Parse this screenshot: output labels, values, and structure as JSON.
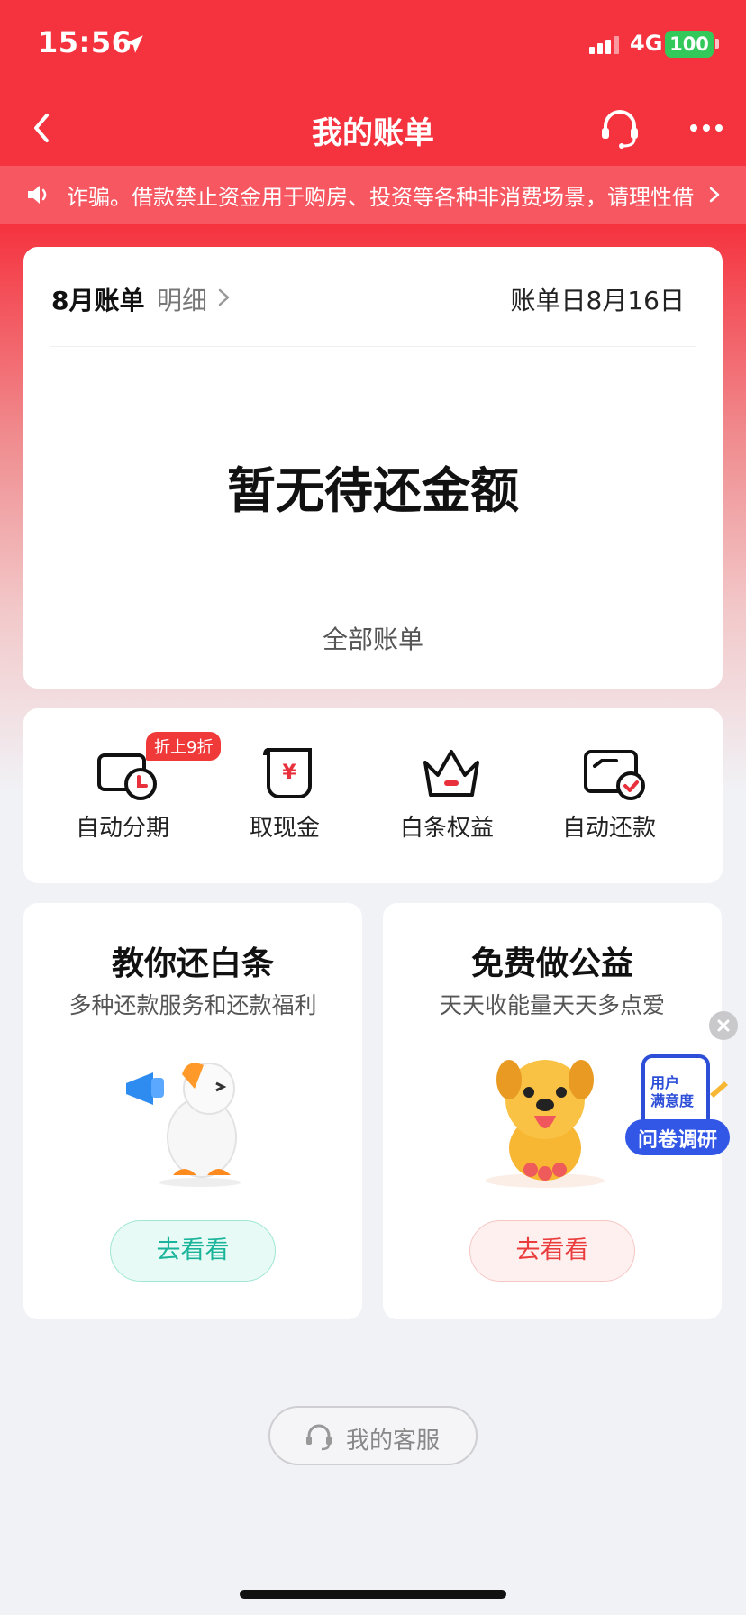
{
  "status_bar": {
    "time": "15:56",
    "network": "4G",
    "battery": "100"
  },
  "nav": {
    "title": "我的账单"
  },
  "notice": {
    "text": "诈骗。借款禁止资金用于购房、投资等各种非消费场景，请理性借"
  },
  "bill": {
    "month_label": "8月账单",
    "detail_label": "明细",
    "bill_date": "账单日8月16日",
    "empty_text": "暂无待还金额",
    "all_bills_label": "全部账单"
  },
  "services": {
    "items": [
      {
        "label": "自动分期",
        "icon": "auto-installment-icon",
        "badge": "折上9折"
      },
      {
        "label": "取现金",
        "icon": "cash-withdraw-icon"
      },
      {
        "label": "白条权益",
        "icon": "crown-icon"
      },
      {
        "label": "自动还款",
        "icon": "auto-repay-icon"
      }
    ]
  },
  "promos": [
    {
      "title": "教你还白条",
      "subtitle": "多种还款服务和还款福利",
      "button": "去看看",
      "illustration": "duck-megaphone-illustration"
    },
    {
      "title": "免费做公益",
      "subtitle": "天天收能量天天多点爱",
      "button": "去看看",
      "illustration": "dog-mascot-illustration"
    }
  ],
  "survey": {
    "line1": "用户",
    "line2": "满意度",
    "button": "问卷调研"
  },
  "support": {
    "label": "我的客服"
  },
  "colors": {
    "brand_red": "#f5333f",
    "teal": "#19b49a",
    "badge_red": "#f03a3a"
  }
}
